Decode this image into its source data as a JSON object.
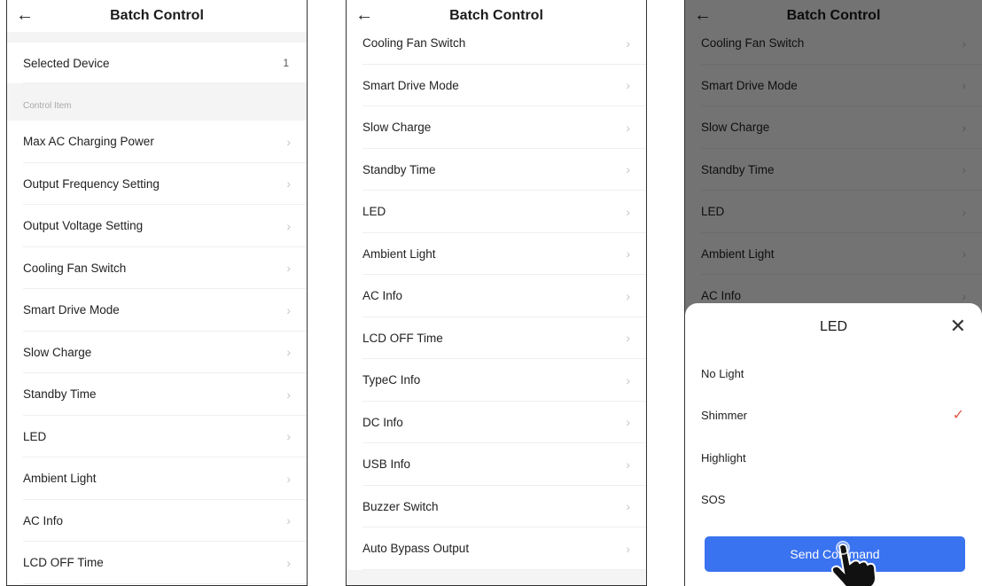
{
  "header": {
    "title": "Batch Control",
    "back_icon": "←"
  },
  "screen1": {
    "selected_device_label": "Selected Device",
    "selected_device_value": "1",
    "section_label": "Control Item",
    "items": [
      "Max AC Charging Power",
      "Output Frequency Setting",
      "Output Voltage Setting",
      "Cooling Fan Switch",
      "Smart Drive Mode",
      "Slow Charge",
      "Standby Time",
      "LED",
      "Ambient Light",
      "AC Info",
      "LCD OFF Time"
    ]
  },
  "screen2": {
    "items": [
      "Cooling Fan Switch",
      "Smart Drive Mode",
      "Slow Charge",
      "Standby Time",
      "LED",
      "Ambient Light",
      "AC Info",
      "LCD OFF Time",
      "TypeC Info",
      "DC Info",
      "USB Info",
      "Buzzer Switch",
      "Auto Bypass Output"
    ]
  },
  "screen3": {
    "items": [
      "Cooling Fan Switch",
      "Smart Drive Mode",
      "Slow Charge",
      "Standby Time",
      "LED",
      "Ambient Light",
      "AC Info"
    ],
    "sheet": {
      "title": "LED",
      "close_icon": "✕",
      "options": [
        "No Light",
        "Shimmer",
        "Highlight",
        "SOS"
      ],
      "selected": "Shimmer",
      "check_icon": "✓",
      "send_label": "Send Command"
    }
  },
  "chevron": "›",
  "colors": {
    "accent": "#3a73f0",
    "check": "#e4574b",
    "dim_overlay": "rgba(0,0,0,0.55)"
  }
}
